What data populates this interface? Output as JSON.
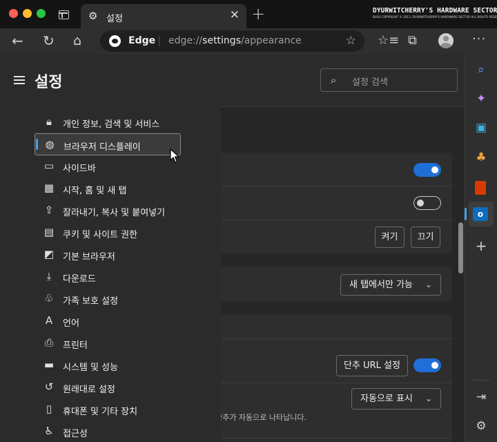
{
  "window": {
    "tab_title": "설정",
    "watermark_title": "DYURWITCHERRY'S HARDWARE SECTOR",
    "watermark_sub": "BLOG COPYRIGHT © 2013. DYURWITCHERRY'S HARDWARE SECTOR ALL RIGHTS RESERVED."
  },
  "toolbar": {
    "brand": "Edge",
    "url_prefix": "edge://",
    "url_host": "settings",
    "url_path": "/appearance"
  },
  "settings_nav": {
    "title": "설정",
    "search_placeholder": "설정 검색",
    "selected_index": 1,
    "items": [
      {
        "label": "개인 정보, 검색 및 서비스",
        "icon": "lock-icon"
      },
      {
        "label": "브라우저 디스플레이",
        "icon": "palette-icon"
      },
      {
        "label": "사이드바",
        "icon": "sidebar-icon"
      },
      {
        "label": "시작, 홈 및 새 탭",
        "icon": "home-grid-icon"
      },
      {
        "label": "잘라내기, 복사 및 붙여넣기",
        "icon": "share-icon"
      },
      {
        "label": "쿠키 및 사이트 권한",
        "icon": "site-permissions-icon"
      },
      {
        "label": "기본 브라우저",
        "icon": "default-browser-icon"
      },
      {
        "label": "다운로드",
        "icon": "download-icon"
      },
      {
        "label": "가족 보호 설정",
        "icon": "family-icon"
      },
      {
        "label": "언어",
        "icon": "language-icon"
      },
      {
        "label": "프린터",
        "icon": "printer-icon"
      },
      {
        "label": "시스템 및 성능",
        "icon": "laptop-icon"
      },
      {
        "label": "원래대로 설정",
        "icon": "reset-icon"
      },
      {
        "label": "휴대폰 및 기타 장치",
        "icon": "phone-icon"
      },
      {
        "label": "접근성",
        "icon": "accessibility-icon"
      }
    ]
  },
  "main": {
    "on_button": "켜기",
    "off_button": "끄기",
    "new_tab_dropdown": "새 탭에서만 가능",
    "shortcut_url_button": "단추 URL 설정",
    "auto_show_dropdown": "자동으로 표시",
    "hint_text": "]] 단추가 자동으로 나타납니다.",
    "toggles": {
      "row1": true,
      "row2": false,
      "shortcut": true
    }
  },
  "colors": {
    "accent": "#1f6fd6",
    "selection_bar": "#4a9fe8"
  }
}
